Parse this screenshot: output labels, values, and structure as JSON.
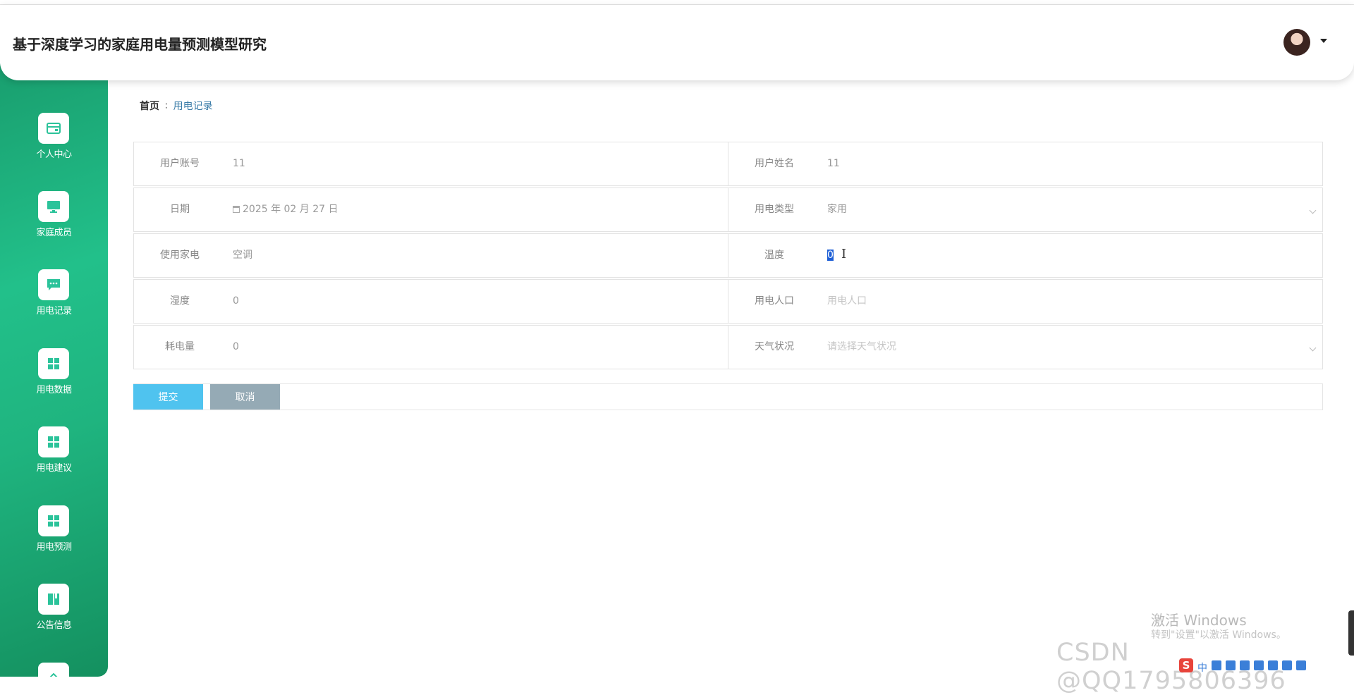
{
  "app": {
    "title": "基于深度学习的家庭用电量预测模型研究"
  },
  "sidebar": {
    "items": [
      {
        "label": "个人中心",
        "icon": "card-icon"
      },
      {
        "label": "家庭成员",
        "icon": "monitor-icon"
      },
      {
        "label": "用电记录",
        "icon": "chat-icon"
      },
      {
        "label": "用电数据",
        "icon": "grid-icon"
      },
      {
        "label": "用电建议",
        "icon": "grid-icon"
      },
      {
        "label": "用电预测",
        "icon": "grid-icon"
      },
      {
        "label": "公告信息",
        "icon": "book-icon"
      }
    ]
  },
  "breadcrumb": {
    "home": "首页",
    "separator": "∶",
    "current": "用电记录"
  },
  "form": {
    "user_account": {
      "label": "用户账号",
      "value": "11"
    },
    "user_name": {
      "label": "用户姓名",
      "value": "11"
    },
    "date": {
      "label": "日期",
      "value": "2025 年 02 月 27 日"
    },
    "usage_type": {
      "label": "用电类型",
      "value": "家用"
    },
    "appliance": {
      "label": "使用家电",
      "value": "空调"
    },
    "temperature": {
      "label": "温度",
      "value": "0"
    },
    "humidity": {
      "label": "湿度",
      "value": "0"
    },
    "population": {
      "label": "用电人口",
      "placeholder": "用电人口"
    },
    "consumption": {
      "label": "耗电量",
      "value": "0"
    },
    "weather": {
      "label": "天气状况",
      "placeholder": "请选择天气状况"
    }
  },
  "buttons": {
    "submit": "提交",
    "cancel": "取消"
  },
  "overlay": {
    "activate_title": "激活 Windows",
    "activate_hint": "转到\"设置\"以激活 Windows。",
    "csdn_watermark": "CSDN @QQ1795806396",
    "ime_glyph": "S",
    "ime_mode": "中"
  },
  "colors": {
    "sidebar_green": "#1fb47f",
    "submit_blue": "#4fc3ef",
    "cancel_gray": "#95aab5",
    "breadcrumb_link": "#3a7ca8"
  }
}
